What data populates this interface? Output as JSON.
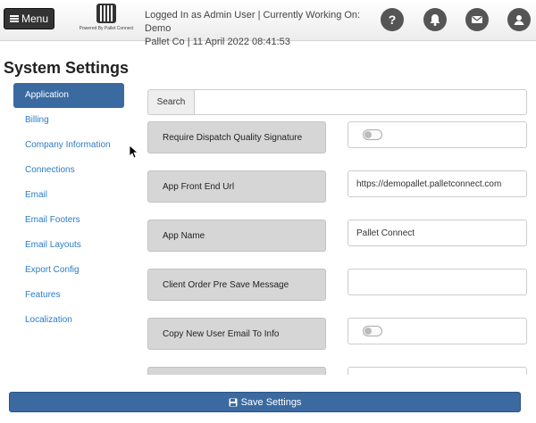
{
  "header": {
    "menu_label": "Menu",
    "logo_text": "Powered By Pallet Connect",
    "user_line_1": "Logged In as Admin User | Currently Working On: Demo",
    "user_line_2": "Pallet Co | 11 April 2022 08:41:53",
    "icons": [
      "help-icon",
      "bell-icon",
      "mail-icon",
      "user-icon"
    ]
  },
  "page": {
    "title": "System Settings"
  },
  "sidebar": {
    "items": [
      {
        "label": "Application",
        "active": true
      },
      {
        "label": "Billing"
      },
      {
        "label": "Company Information"
      },
      {
        "label": "Connections"
      },
      {
        "label": "Email"
      },
      {
        "label": "Email Footers"
      },
      {
        "label": "Email Layouts"
      },
      {
        "label": "Export Config"
      },
      {
        "label": "Features"
      },
      {
        "label": "Localization"
      }
    ]
  },
  "search": {
    "label": "Search",
    "value": "",
    "placeholder": ""
  },
  "settings": [
    {
      "label": "Require Dispatch Quality Signature",
      "type": "toggle",
      "checked": false
    },
    {
      "label": "App Front End Url",
      "type": "text",
      "value": "https://demopallet.palletconnect.com"
    },
    {
      "label": "App Name",
      "type": "text",
      "value": "Pallet Connect"
    },
    {
      "label": "Client Order Pre Save Message",
      "type": "text",
      "value": ""
    },
    {
      "label": "Copy New User Email To Info",
      "type": "toggle",
      "checked": false
    },
    {
      "label": "",
      "type": "text",
      "value": ""
    }
  ],
  "footer": {
    "save_label": "Save Settings"
  },
  "colors": {
    "primary": "#3a6aa0",
    "link": "#2a7cc7",
    "menu_bg": "#333333"
  }
}
